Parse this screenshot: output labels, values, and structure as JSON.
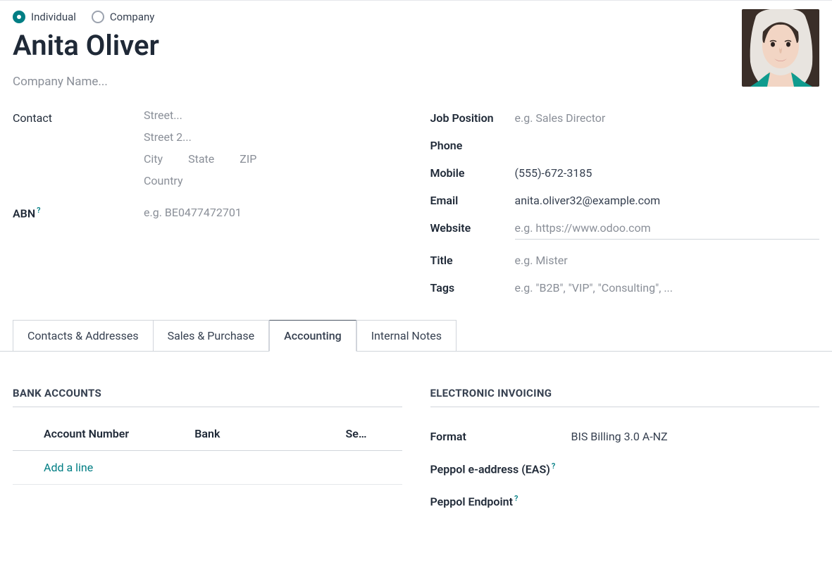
{
  "radio": {
    "individual": "Individual",
    "company": "Company",
    "selected": "individual"
  },
  "name": "Anita Oliver",
  "company_placeholder": "Company Name...",
  "left": {
    "contact_label": "Contact",
    "address": {
      "street": "Street...",
      "street2": "Street 2...",
      "city": "City",
      "state": "State",
      "zip": "ZIP",
      "country": "Country"
    },
    "abn_label": "ABN",
    "abn_placeholder": "e.g. BE0477472701"
  },
  "right": {
    "job_position": {
      "label": "Job Position",
      "placeholder": "e.g. Sales Director"
    },
    "phone": {
      "label": "Phone",
      "value": ""
    },
    "mobile": {
      "label": "Mobile",
      "value": "(555)-672-3185"
    },
    "email": {
      "label": "Email",
      "value": "anita.oliver32@example.com"
    },
    "website": {
      "label": "Website",
      "placeholder": "e.g. https://www.odoo.com"
    },
    "title": {
      "label": "Title",
      "placeholder": "e.g. Mister"
    },
    "tags": {
      "label": "Tags",
      "placeholder": "e.g. \"B2B\", \"VIP\", \"Consulting\", ..."
    }
  },
  "tabs": {
    "contacts": "Contacts & Addresses",
    "sales": "Sales & Purchase",
    "accounting": "Accounting",
    "notes": "Internal Notes",
    "active": "accounting"
  },
  "bank": {
    "section_title": "BANK ACCOUNTS",
    "col_account": "Account Number",
    "col_bank": "Bank",
    "col_send": "Se…",
    "add_line": "Add a line"
  },
  "einv": {
    "section_title": "ELECTRONIC INVOICING",
    "format": {
      "label": "Format",
      "value": "BIS Billing 3.0 A-NZ"
    },
    "peppol_eas": {
      "label": "Peppol e-address (EAS)"
    },
    "peppol_endpoint": {
      "label": "Peppol Endpoint"
    }
  },
  "help_glyph": "?"
}
